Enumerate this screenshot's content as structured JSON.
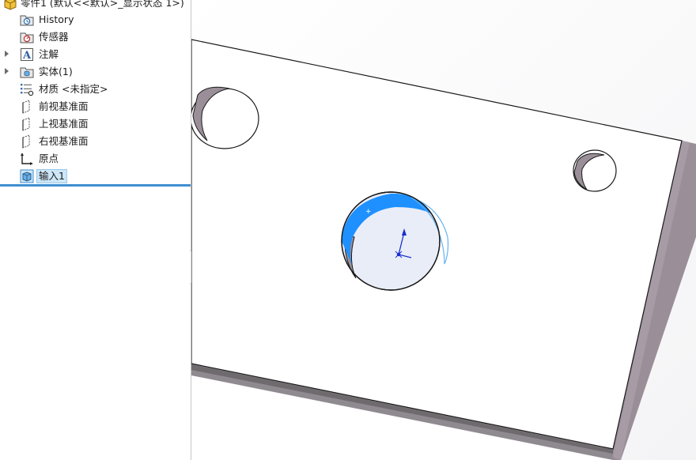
{
  "tree": {
    "root_label": "零件1 (默认<<默认>_显示状态 1>)",
    "items": [
      {
        "label": "History",
        "icon": "history-folder-icon",
        "expandable": false
      },
      {
        "label": "传感器",
        "icon": "sensor-folder-icon",
        "expandable": false
      },
      {
        "label": "注解",
        "icon": "annotation-icon",
        "expandable": true
      },
      {
        "label": "实体(1)",
        "icon": "solid-bodies-icon",
        "expandable": true
      },
      {
        "label": "材质 <未指定>",
        "icon": "material-icon",
        "expandable": false
      },
      {
        "label": "前视基准面",
        "icon": "plane-icon",
        "expandable": false
      },
      {
        "label": "上视基准面",
        "icon": "plane-icon",
        "expandable": false
      },
      {
        "label": "右视基准面",
        "icon": "plane-icon",
        "expandable": false
      },
      {
        "label": "原点",
        "icon": "origin-icon",
        "expandable": false
      },
      {
        "label": "输入1",
        "icon": "imported-body-icon",
        "expandable": false,
        "selected": true
      }
    ]
  },
  "colors": {
    "accent": "#3f8fd2",
    "selection_fill": "#cde6f7",
    "highlight_face": "#1e90ff",
    "plate_edge": "#9a8f98"
  }
}
